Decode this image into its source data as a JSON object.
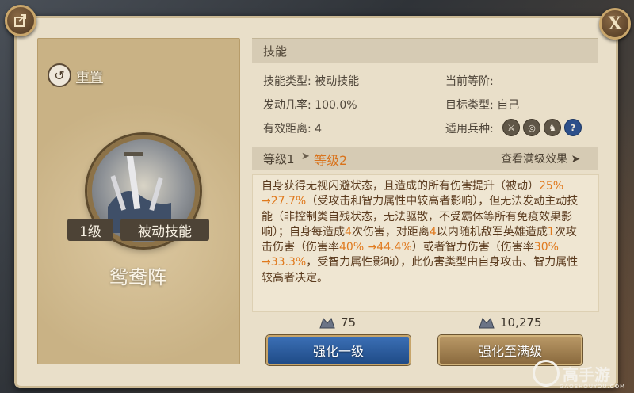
{
  "header": {
    "close_label": "X"
  },
  "left_card": {
    "reset_label": "重置",
    "skill_level": "1级",
    "skill_type_tag": "被动技能",
    "skill_name": "鸳鸯阵"
  },
  "skills_section": {
    "title": "技能",
    "type_label": "技能类型:",
    "type_value": "被动技能",
    "current_stage_label": "当前等阶:",
    "trigger_label": "发动几率:",
    "trigger_value": "100.0%",
    "target_label": "目标类型:",
    "target_value": "自己",
    "range_label": "有效距离:",
    "range_value": "4",
    "troops_label": "适用兵种:"
  },
  "level_bar": {
    "level1": "等级1",
    "arrow": "➤",
    "level2": "等级2",
    "max_effect": "查看满级效果 ➤"
  },
  "description": {
    "p1": "自身获得无视闪避状态，且造成的所有伤害提升（被动）",
    "h1": "25% →27.7%",
    "p2": "（受攻击和智力属性中较高者影响），但无法发动主动技能（非控制类自残状态，无法驱散，不受霸体等所有免疫效果影响）；自身每造成",
    "h2": "4",
    "p3": "次伤害，对距离",
    "h3": "4",
    "p4": "以内随机敌军英雄造成",
    "h4": "1",
    "p5": "次攻击伤害（伤害率",
    "h5": "40% →44.4%",
    "p6": "）或者智力伤害（伤害率",
    "h6": "30% →33.3%",
    "p7": "，受智力属性影响），此伤害类型由自身攻击、智力属性较高者决定。"
  },
  "costs": {
    "upgrade_one": "75",
    "upgrade_max": "10,275"
  },
  "buttons": {
    "upgrade_one": "强化一级",
    "upgrade_max": "强化至满级"
  },
  "watermark": {
    "brand": "高手游",
    "sub": "GAOSHOUYOU.COM"
  },
  "colors": {
    "highlight": "#e07a1e",
    "blue_button": "#1f4b87",
    "gold_button": "#8a6a3e"
  }
}
